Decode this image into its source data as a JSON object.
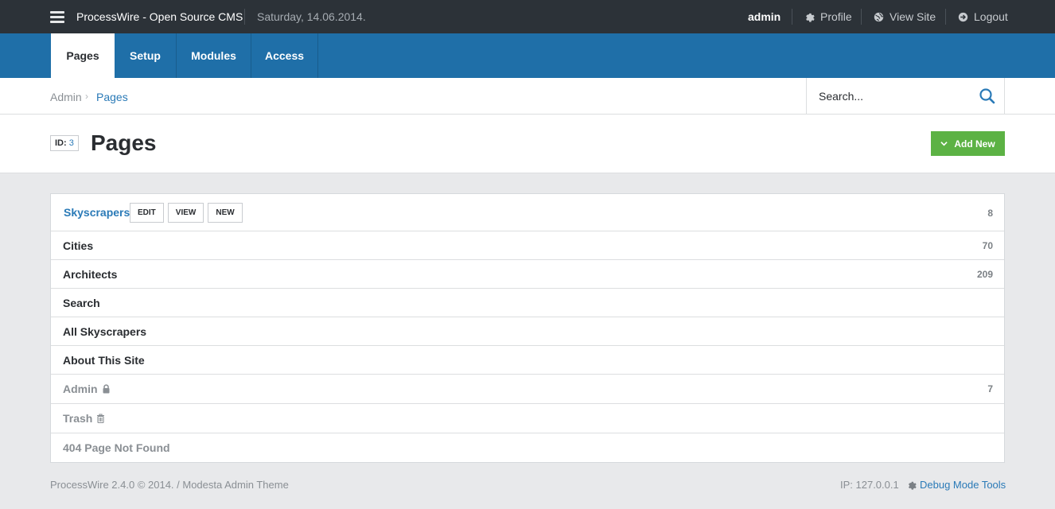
{
  "topbar": {
    "site_title": "ProcessWire - Open Source CMS",
    "date": "Saturday, 14.06.2014.",
    "user": "admin",
    "profile_label": "Profile",
    "view_site_label": "View Site",
    "logout_label": "Logout",
    "icons": [
      "menu-icon",
      "gear-icon",
      "globe-icon",
      "logout-icon"
    ]
  },
  "nav": {
    "tabs": [
      {
        "label": "Pages",
        "active": true
      },
      {
        "label": "Setup",
        "active": false
      },
      {
        "label": "Modules",
        "active": false
      },
      {
        "label": "Access",
        "active": false
      }
    ]
  },
  "breadcrumb": {
    "items": [
      "Admin",
      "Pages"
    ],
    "separator": "›"
  },
  "search": {
    "placeholder": "Search..."
  },
  "header": {
    "id_label": "ID:",
    "id_value": "3",
    "title": "Pages",
    "add_new_label": "Add New"
  },
  "pages": {
    "root": {
      "title": "Skyscrapers",
      "count": "8",
      "actions": [
        "EDIT",
        "VIEW",
        "NEW"
      ]
    },
    "rows": [
      {
        "title": "Cities",
        "count": "70"
      },
      {
        "title": "Architects",
        "count": "209"
      },
      {
        "title": "Search",
        "count": ""
      },
      {
        "title": "All Skyscrapers",
        "count": ""
      },
      {
        "title": "About This Site",
        "count": ""
      },
      {
        "title": "Admin",
        "count": "7",
        "icon": "lock-icon"
      },
      {
        "title": "Trash",
        "count": "",
        "icon": "trash-icon"
      },
      {
        "title": "404 Page Not Found",
        "count": ""
      }
    ]
  },
  "footer": {
    "left": "ProcessWire 2.4.0 © 2014. / Modesta Admin Theme",
    "ip": "IP: 127.0.0.1",
    "debug": "Debug Mode Tools"
  },
  "colors": {
    "topbar_bg": "#2c3238",
    "nav_bg": "#1f6fa8",
    "accent_link": "#2a7ab7",
    "add_button": "#5cb244",
    "page_bg": "#e8e9eb"
  }
}
